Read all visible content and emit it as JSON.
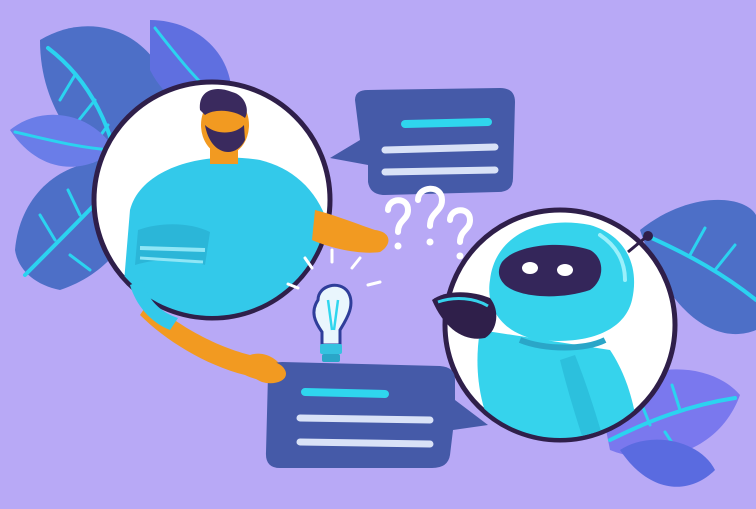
{
  "scene": {
    "colors": {
      "background": "#b8a9f6",
      "leaf_primary": "#4d6fc7",
      "leaf_secondary": "#6c7fe6",
      "leaf_vein": "#2bd3f0",
      "bubble": "#455aa8",
      "bubble_line_accent": "#2fd6ee",
      "bubble_line": "#d9e2f7",
      "circle_outline": "#2f1f4a",
      "circle_fill": "#ffffff",
      "shirt": "#33c9ea",
      "skin": "#f29a21",
      "hair": "#3a2a5e",
      "robot_body": "#36d3ec",
      "robot_visor": "#34265a",
      "question_marks": "#ffffff",
      "bulb": "#e9f6fd"
    },
    "icons": {
      "person": "person-chatting-icon",
      "robot": "chatbot-robot-icon",
      "idea": "lightbulb-icon",
      "confusion": "question-marks-icon",
      "message_top": "speech-bubble-icon",
      "message_bottom": "speech-bubble-icon"
    }
  }
}
